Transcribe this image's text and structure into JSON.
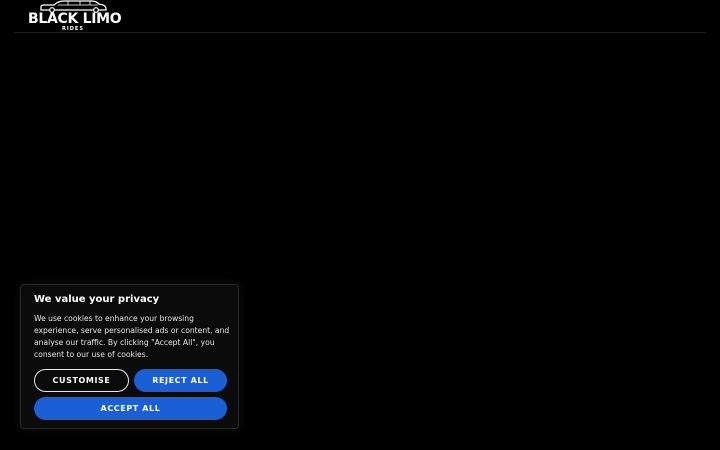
{
  "header": {
    "logo_main": "BLACK LIMO",
    "logo_sub": "RIDES",
    "logo_icon": "limousine-icon"
  },
  "cookie_banner": {
    "title": "We value your privacy",
    "body": "We use cookies to enhance your browsing experience, serve personalised ads or content, and analyse our traffic. By clicking \"Accept All\", you consent to our use of cookies.",
    "customise_label": "CUSTOMISE",
    "reject_label": "REJECT ALL",
    "accept_label": "ACCEPT ALL"
  },
  "colors": {
    "background": "#000000",
    "button_blue": "#1a5fd6",
    "text": "#ffffff"
  }
}
